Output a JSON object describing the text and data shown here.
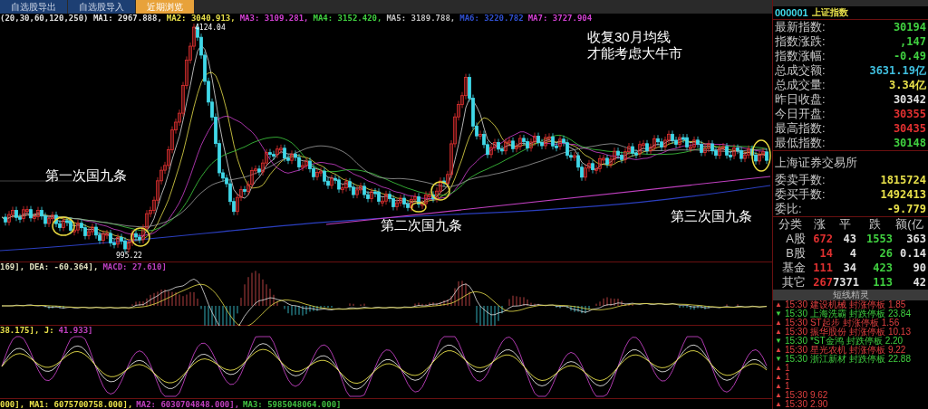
{
  "tabs": [
    {
      "label": "自选股导出",
      "selected": false
    },
    {
      "label": "自选股导入",
      "selected": false
    },
    {
      "label": "近期浏览",
      "selected": true
    }
  ],
  "main_chart": {
    "legend": [
      {
        "text": "(20,30,60,120,250) MA1: 2967.888,",
        "color": "#e0e0e0"
      },
      {
        "text": "MA2: 3040.913,",
        "color": "#e8e04a"
      },
      {
        "text": "MA3: 3109.281,",
        "color": "#d040d0"
      },
      {
        "text": "MA4: 3152.420,",
        "color": "#40d040"
      },
      {
        "text": "MA5: 3189.788,",
        "color": "#c0c0c0"
      },
      {
        "text": "MA6: 3220.782",
        "color": "#3050d0"
      },
      {
        "text": "MA7: 3727.904",
        "color": "#d040d0"
      }
    ],
    "high_label": "4124.04",
    "low_label": "995.22",
    "annotations": [
      {
        "text": "收复30月均线"
      },
      {
        "text": "才能考虑大牛市"
      },
      {
        "text": "第一次国九条"
      },
      {
        "text": "第二次国九条"
      },
      {
        "text": "第三次国九条"
      }
    ]
  },
  "macd": {
    "legend": [
      {
        "text": "169], DEA: -60.364],",
        "color": "#e0e0c0"
      },
      {
        "text": "MACD: 27.610]",
        "color": "#c040c0"
      }
    ]
  },
  "kdj": {
    "legend": [
      {
        "text": "38.175], J:",
        "color": "#e8e04a"
      },
      {
        "text": "41.933]",
        "color": "#c040c0"
      }
    ]
  },
  "volume": {
    "legend": [
      {
        "text": "000], MA1: 6075700758.000],",
        "color": "#e8e04a"
      },
      {
        "text": "MA2: 6030704848.000],",
        "color": "#c040c0"
      },
      {
        "text": "MA3: 5985048064.000]",
        "color": "#40c040"
      }
    ]
  },
  "quote_panel": {
    "code": "000001",
    "name": "上证指数",
    "rows": [
      {
        "label": "最新指数:",
        "value": "30194",
        "color": "#40d040"
      },
      {
        "label": "指数涨跌:",
        "value": ",147",
        "color": "#40d040"
      },
      {
        "label": "指数涨幅:",
        "value": "-0.49",
        "color": "#40d040"
      },
      {
        "label": "总成交额:",
        "value": "3631.19亿",
        "color": "#40c0e0"
      },
      {
        "label": "总成交量:",
        "value": "3.34亿",
        "color": "#e8e04a"
      },
      {
        "label": "昨日收盘:",
        "value": "30342",
        "color": "#e0e0e0"
      },
      {
        "label": "今日开盘:",
        "value": "30355",
        "color": "#e03030"
      },
      {
        "label": "最高指数:",
        "value": "30435",
        "color": "#e03030"
      },
      {
        "label": "最低指数:",
        "value": "30148",
        "color": "#40d040"
      }
    ],
    "exchange": "上海证券交易所",
    "orders": [
      {
        "label": "委卖手数:",
        "value": "1815724"
      },
      {
        "label": "委买手数:",
        "value": "1492413"
      },
      {
        "label": "委比:",
        "value": "-9.779"
      }
    ],
    "table": {
      "columns": [
        "分类",
        "涨",
        "平",
        "跌",
        "额(亿"
      ],
      "rows": [
        [
          "A股",
          "672",
          "43",
          "1553",
          "363"
        ],
        [
          "B股",
          "14",
          "4",
          "26",
          "0.14"
        ],
        [
          "基金",
          "111",
          "34",
          "423",
          "90"
        ],
        [
          "其它",
          "267",
          "7371",
          "113",
          "42"
        ]
      ]
    }
  },
  "alerts": {
    "title": "短线精灵",
    "items": [
      {
        "kind": "up",
        "marker": "▲",
        "time": "15:30",
        "name": "建设机械",
        "event": "封涨停板",
        "value": "1.85"
      },
      {
        "kind": "down",
        "marker": "▼",
        "time": "15:30",
        "name": "上海洗霸",
        "event": "封跌停板",
        "value": "23.84"
      },
      {
        "kind": "up",
        "marker": "▲",
        "time": "15:30",
        "name": "ST起步",
        "event": "封涨停板",
        "value": "1.56"
      },
      {
        "kind": "up",
        "marker": "▲",
        "time": "15:30",
        "name": "振华股份",
        "event": "封涨停板",
        "value": "10.13"
      },
      {
        "kind": "down",
        "marker": "▼",
        "time": "15:30",
        "name": "*ST金鸿",
        "event": "封跌停板",
        "value": "2.20"
      },
      {
        "kind": "up",
        "marker": "▲",
        "time": "15:30",
        "name": "星光农机",
        "event": "封涨停板",
        "value": "9.22"
      },
      {
        "kind": "down",
        "marker": "▼",
        "time": "15:30",
        "name": "浙江新材",
        "event": "封跌停板",
        "value": "22.88"
      },
      {
        "kind": "up",
        "marker": "▲",
        "time": "1"
      },
      {
        "kind": "up",
        "marker": "▲",
        "time": "1"
      },
      {
        "kind": "up",
        "marker": "▲",
        "time": "1"
      },
      {
        "kind": "up",
        "marker": "▲",
        "time": "15:30",
        "value": "9.62"
      },
      {
        "kind": "up",
        "marker": "▲",
        "time": "15:30",
        "value": "2.90"
      }
    ]
  }
}
